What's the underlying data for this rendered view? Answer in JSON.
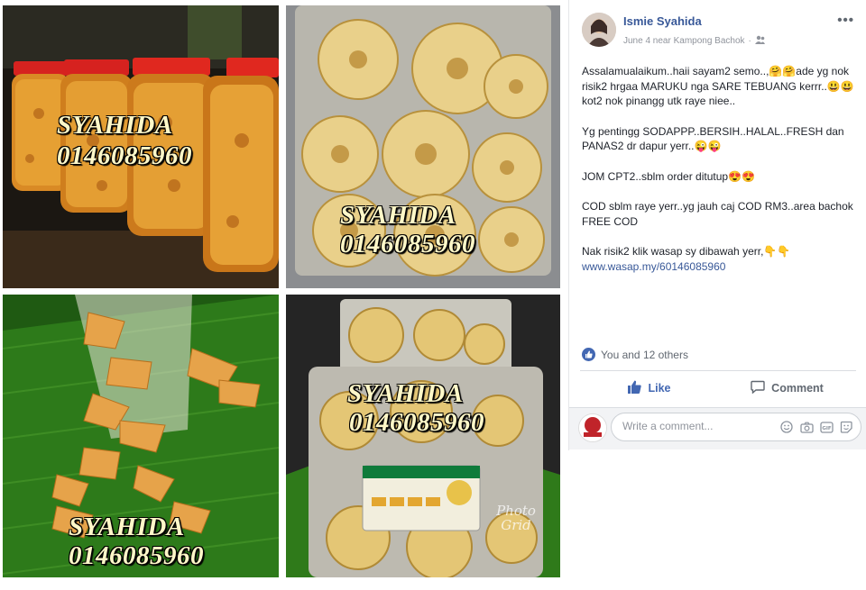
{
  "watermark": {
    "name": "SYAHIDA",
    "phone": "0146085960"
  },
  "photo_grid_label": "Photo Grid",
  "post": {
    "author": "Ismie Syahida",
    "date": "June 4 near Kampong Bachok",
    "privacy_icon": "friends-icon",
    "more_label": "•••",
    "paragraphs": [
      "Assalamualaikum..haii sayam2 semo..,🤗🤗ade yg nok risik2 hrgaa MARUKU nga SARE TEBUANG kerrr..😃😃kot2 nok pinangg utk raye niee..",
      "Yg pentingg SODAPPP..BERSIH..HALAL..FRESH dan PANAS2 dr dapur yerr..😜😜",
      "JOM CPT2..sblm order ditutup😍😍",
      "COD sblm raye yerr..yg jauh caj COD RM3..area bachok FREE COD",
      "Nak risik2 klik wasap sy dibawah yerr,👇👇"
    ],
    "link": "www.wasap.my/60146085960",
    "reactions_text": "You and 12 others",
    "like_label": "Like",
    "comment_label": "Comment",
    "comment_placeholder": "Write a comment..."
  },
  "colors": {
    "link": "#385898",
    "like_blue": "#4267b2",
    "text": "#1d2129",
    "muted": "#90949c"
  }
}
